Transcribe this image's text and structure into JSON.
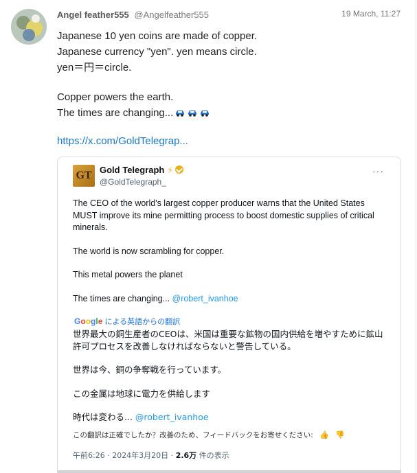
{
  "post": {
    "display_name": "Angel feather555",
    "handle": "@Angelfeather555",
    "timestamp": "19 March, 11:27",
    "lines": [
      "Japanese 10 yen coins are made of copper.",
      "Japanese currency \"yen\". yen means circle.",
      "yen＝円＝circle.",
      "Copper powers the earth.",
      "The times are changing..."
    ],
    "link": "https://x.com/GoldTelegrap..."
  },
  "embed": {
    "name": "Gold Telegraph",
    "handle": "@GoldTelegraph_",
    "logo_text": "GT",
    "more_label": "···",
    "paragraphs": [
      "The CEO of the world's largest copper producer warns that the United States MUST improve its mine permitting process to boost domestic supplies of critical minerals.",
      "The world is now scrambling for copper.",
      "This metal powers the planet"
    ],
    "last_line": "The times are changing...",
    "mention": "@robert_ivanhoe",
    "translate_label": "による英語からの翻訳",
    "translate_brand": "Google",
    "jp_paragraphs": [
      "世界最大の銅生産者のCEOは、米国は重要な鉱物の国内供給を増やすために鉱山許可プロセスを改善しなければならないと警告している。",
      "世界は今、銅の争奪戦を行っています。",
      "この金属は地球に電力を供給します"
    ],
    "jp_last_line": "時代は変わる...",
    "feedback": "この翻訳は正確でしたか？改善のため、フィードバックをお寄せください:",
    "meta_time": "午前6:26 · 2024年3月20日 ·",
    "views": "2.6万",
    "views_label": "件の表示"
  },
  "colors": {
    "link": "#1a78c9",
    "mention": "#1d9bf0",
    "verified": "#e8b21c"
  }
}
